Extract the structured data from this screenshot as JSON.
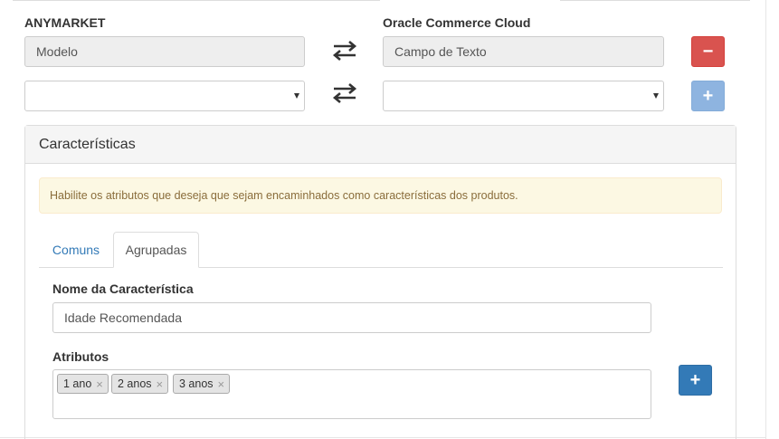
{
  "mapping": {
    "left_title": "ANYMARKET",
    "right_title": "Oracle Commerce Cloud",
    "rows": [
      {
        "left_value": "Modelo",
        "right_value": "Campo de Texto",
        "action": "−"
      },
      {
        "left_value": "",
        "right_value": "",
        "action": "+"
      }
    ]
  },
  "features_panel": {
    "title": "Características",
    "alert": "Habilite os atributos que deseja que sejam encaminhados como características dos produtos.",
    "tabs": [
      "Comuns",
      "Agrupadas"
    ],
    "active_tab": "Agrupadas",
    "name_label": "Nome da Característica",
    "name_value": "Idade Recomendada",
    "attributes_label": "Atributos",
    "attributes": [
      "1 ano",
      "2 anos",
      "3 anos"
    ],
    "add_label": "+"
  },
  "icons": {
    "swap": "swap-arrows-icon",
    "remove_tag": "×"
  },
  "colors": {
    "danger": "#d9534f",
    "primary": "#337ab7",
    "primary_disabled": "#8eb4e0",
    "alert_bg": "#fcf8e3",
    "alert_text": "#8a6d3b",
    "tab_link": "#337ab7"
  }
}
